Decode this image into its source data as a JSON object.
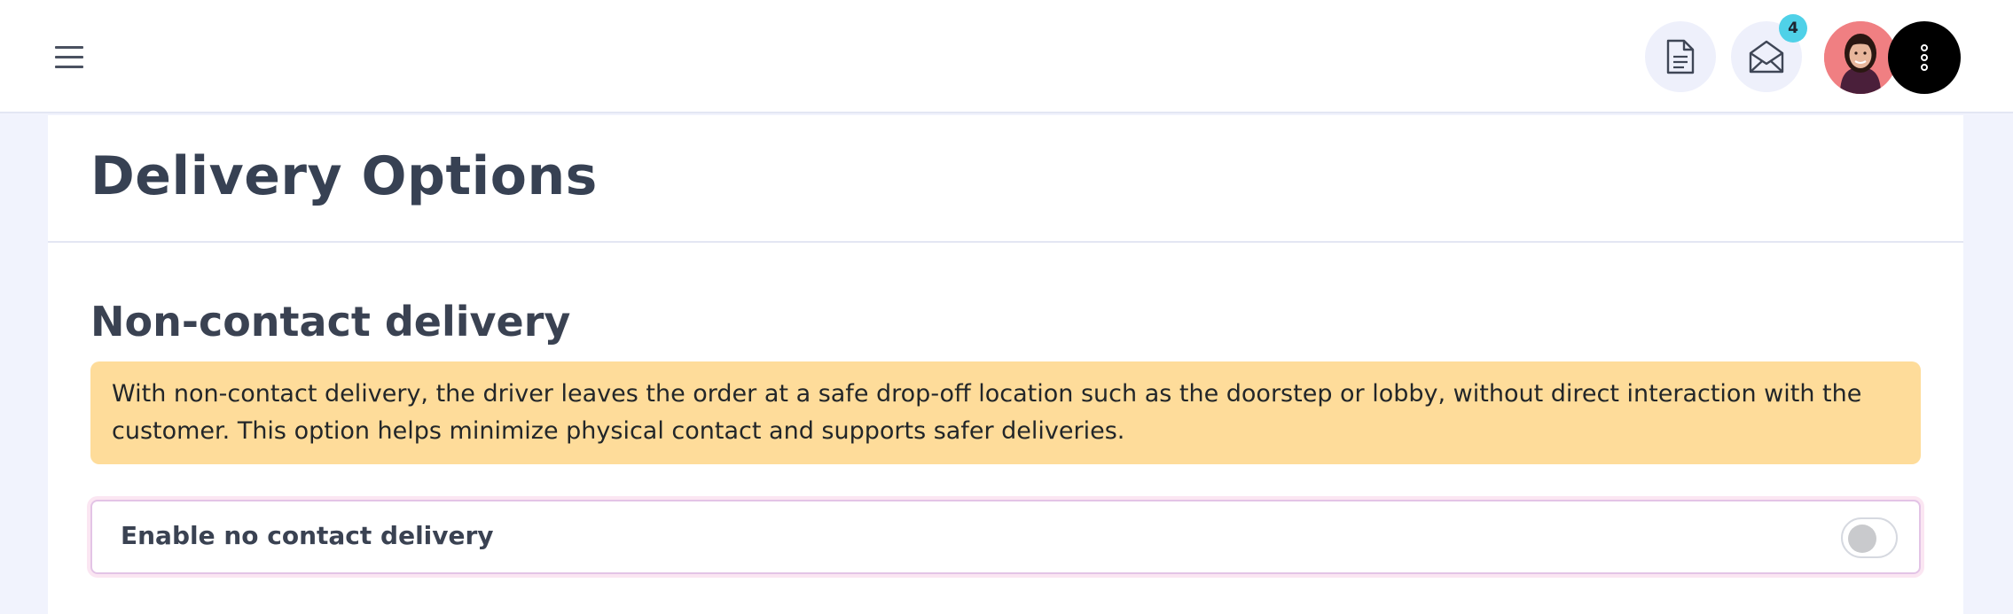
{
  "header": {
    "notifications_badge": "4",
    "icons": {
      "menu": "hamburger-icon",
      "document": "document-icon",
      "mail": "envelope-open-icon",
      "more": "more-vertical-icon"
    },
    "colors": {
      "badge": "#4fd1e8",
      "icon_button_bg": "#eef0fb",
      "avatar_bg": "#f07f82"
    }
  },
  "page": {
    "title": "Delivery Options"
  },
  "section": {
    "heading": "Non-contact delivery",
    "notice": "With non-contact delivery, the driver leaves the order at a safe drop-off location such as the doorstep or lobby, without direct interaction with the customer. This option helps minimize physical contact and supports safer deliveries.",
    "notice_color": "#fedc9a",
    "toggle": {
      "label": "Enable no contact delivery",
      "enabled": false
    }
  }
}
